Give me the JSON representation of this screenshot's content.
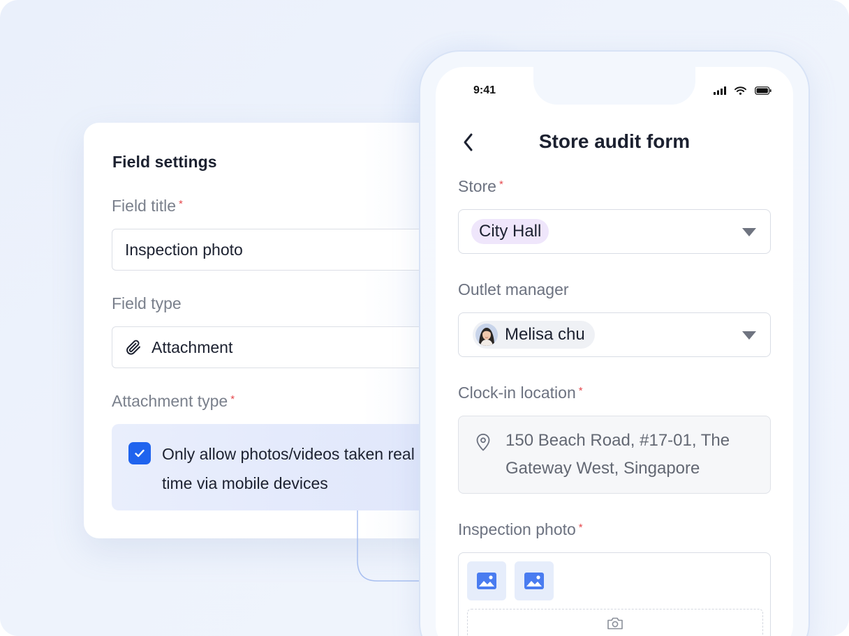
{
  "settings": {
    "title": "Field settings",
    "field_title_label": "Field title",
    "field_title_value": "Inspection photo",
    "field_type_label": "Field type",
    "field_type_value": "Attachment",
    "attachment_type_label": "Attachment type",
    "checkbox_checked": true,
    "checkbox_text": "Only allow photos/videos taken real time via mobile devices",
    "required_mark": "*"
  },
  "phone": {
    "status_time": "9:41",
    "form_title": "Store audit form",
    "store_label": "Store",
    "store_value": "City Hall",
    "manager_label": "Outlet manager",
    "manager_value": "Melisa chu",
    "location_label": "Clock-in location",
    "location_value": "150 Beach Road, #17-01, The Gateway West, Singapore",
    "photo_label": "Inspection photo",
    "photo_count": 2
  },
  "icons": {
    "attachment": "paperclip-icon",
    "checkbox": "check-icon",
    "back": "chevron-left-icon",
    "dropdown": "caret-down-icon",
    "location": "map-pin-icon",
    "image": "image-icon",
    "camera": "camera-icon",
    "signal": "signal-icon",
    "wifi": "wifi-icon",
    "battery": "battery-icon"
  },
  "colors": {
    "accent": "#1f63ee",
    "required": "#e5484d",
    "store_tag": "#efe6fb",
    "image_thumb": "#4a7cf0"
  }
}
